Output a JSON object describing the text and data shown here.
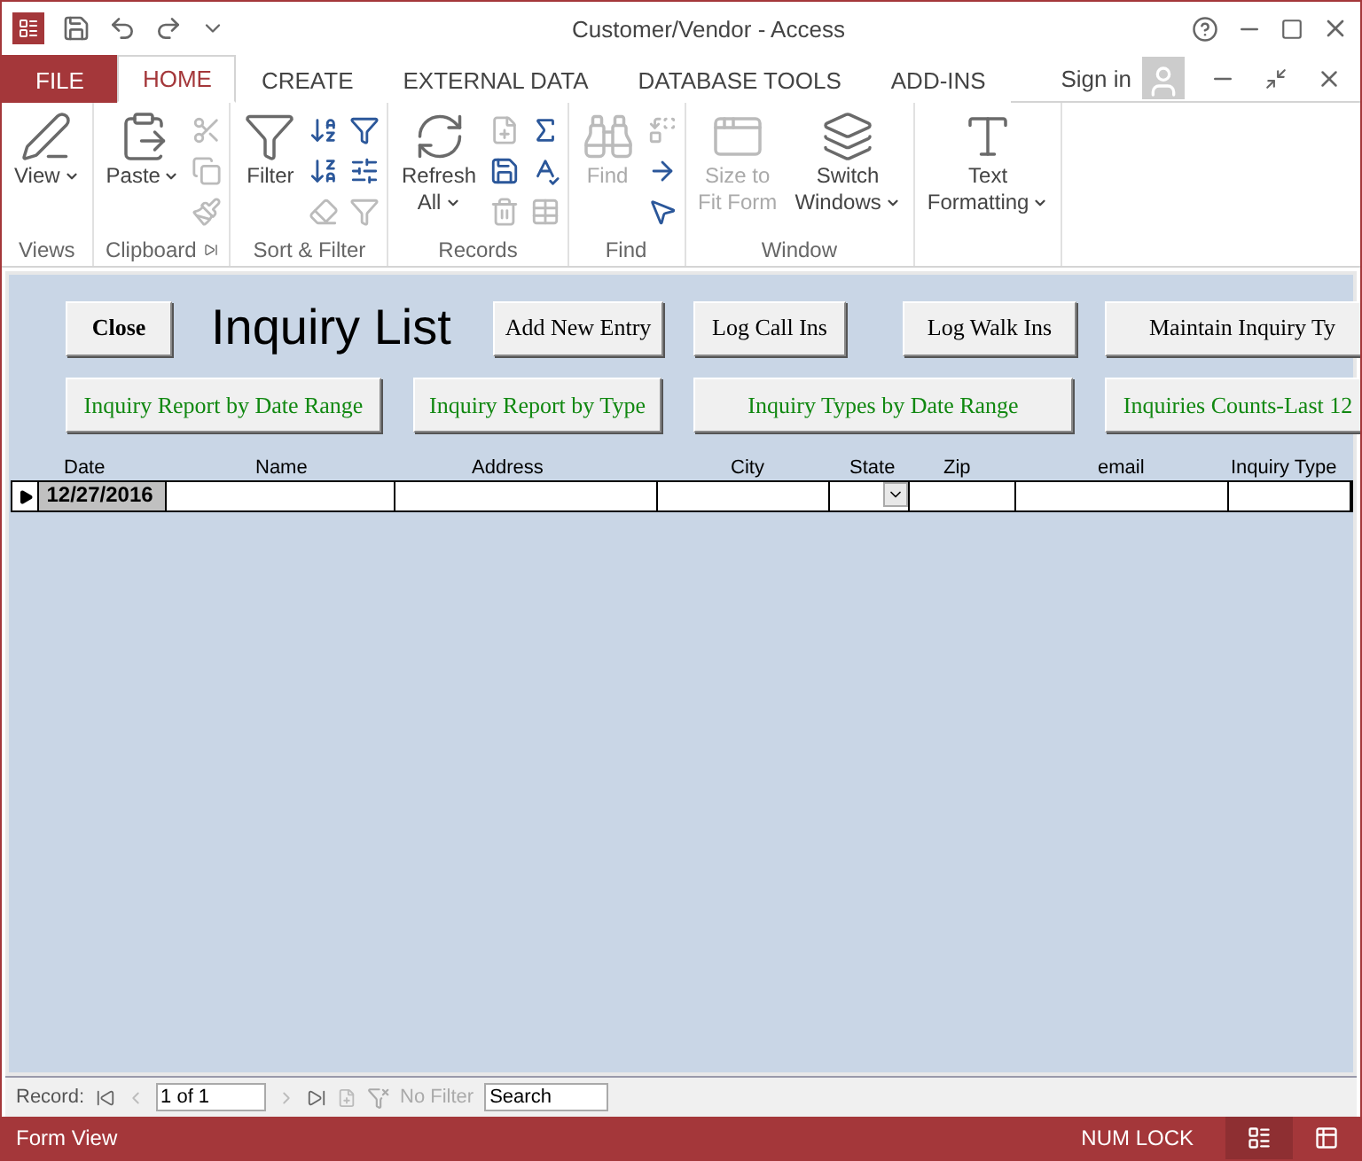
{
  "window": {
    "title": "Customer/Vendor - Access"
  },
  "tabs": [
    {
      "label": "FILE",
      "kind": "file",
      "selected": false
    },
    {
      "label": "HOME",
      "kind": "tab",
      "selected": true
    },
    {
      "label": "CREATE",
      "kind": "tab",
      "selected": false
    },
    {
      "label": "EXTERNAL DATA",
      "kind": "tab",
      "selected": false
    },
    {
      "label": "DATABASE TOOLS",
      "kind": "tab",
      "selected": false
    },
    {
      "label": "ADD-INS",
      "kind": "tab",
      "selected": false
    }
  ],
  "sign_in": "Sign in",
  "ribbon": {
    "groups": [
      {
        "name": "Views",
        "items": [
          {
            "kind": "large",
            "lines": [
              "View"
            ],
            "dropdown": true,
            "disabled": false
          }
        ]
      },
      {
        "name": "Clipboard",
        "launcher": true,
        "items": [
          {
            "kind": "large",
            "lines": [
              "Paste"
            ],
            "dropdown": true,
            "disabled": false
          },
          {
            "kind": "small",
            "disabled": true
          },
          {
            "kind": "small",
            "disabled": true
          },
          {
            "kind": "small",
            "disabled": true
          }
        ]
      },
      {
        "name": "Sort & Filter",
        "items": [
          {
            "kind": "large",
            "lines": [
              "Filter"
            ],
            "disabled": false
          },
          {
            "kind": "small",
            "disabled": false
          },
          {
            "kind": "small",
            "disabled": false
          },
          {
            "kind": "small",
            "disabled": true
          },
          {
            "kind": "small",
            "disabled": false
          },
          {
            "kind": "small",
            "disabled": false
          },
          {
            "kind": "small",
            "disabled": true
          }
        ]
      },
      {
        "name": "Records",
        "items": [
          {
            "kind": "large",
            "lines": [
              "Refresh",
              "All"
            ],
            "dropdown": true,
            "disabled": false
          },
          {
            "kind": "small",
            "disabled": true
          },
          {
            "kind": "small",
            "disabled": false
          },
          {
            "kind": "small",
            "disabled": true
          },
          {
            "kind": "small",
            "disabled": false
          },
          {
            "kind": "small",
            "disabled": false
          },
          {
            "kind": "small",
            "disabled": true
          }
        ]
      },
      {
        "name": "Find",
        "items": [
          {
            "kind": "large",
            "lines": [
              "Find"
            ],
            "disabled": true
          },
          {
            "kind": "small",
            "disabled": true
          },
          {
            "kind": "small",
            "disabled": false
          },
          {
            "kind": "small",
            "disabled": false
          }
        ]
      },
      {
        "name": "Window",
        "items": [
          {
            "kind": "large",
            "lines": [
              "Size to",
              "Fit Form"
            ],
            "disabled": true
          },
          {
            "kind": "large",
            "lines": [
              "Switch",
              "Windows"
            ],
            "dropdown": true,
            "disabled": false
          }
        ]
      },
      {
        "items": [
          {
            "kind": "large",
            "lines": [
              "Text",
              "Formatting"
            ],
            "dropdown": true,
            "disabled": false
          }
        ]
      }
    ]
  },
  "form": {
    "title": "Inquiry List",
    "buttons_top": [
      {
        "label": "Close",
        "kind": "close"
      },
      {
        "label": "Add New Entry",
        "kind": "plain"
      },
      {
        "label": "Log Call Ins",
        "kind": "plain"
      },
      {
        "label": "Log Walk Ins",
        "kind": "plain"
      },
      {
        "label": "Maintain Inquiry Ty",
        "kind": "plain"
      }
    ],
    "buttons_reports": [
      "Inquiry Report by Date Range",
      "Inquiry Report by Type",
      "Inquiry Types by Date Range",
      "Inquiries Counts-Last 12"
    ],
    "columns": [
      "Date",
      "Name",
      "Address",
      "City",
      "State",
      "Zip",
      "email",
      "Inquiry Type"
    ],
    "rows": [
      {
        "current": true,
        "date": "12/27/2016"
      }
    ]
  },
  "record_nav": {
    "label": "Record:",
    "position": "1 of 1",
    "filter": "No Filter",
    "search_placeholder": "Search"
  },
  "status_bar": {
    "view": "Form View",
    "indicator": "NUM LOCK",
    "views": [
      {
        "kind": "form",
        "selected": true
      },
      {
        "kind": "datasheet",
        "selected": false
      }
    ]
  }
}
